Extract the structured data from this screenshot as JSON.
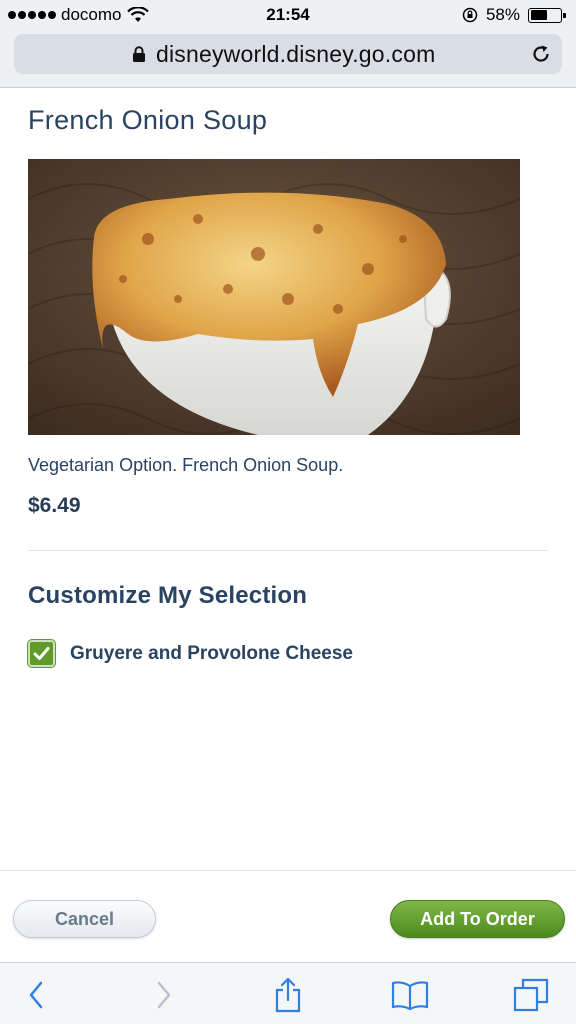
{
  "status_bar": {
    "carrier": "docomo",
    "time": "21:54",
    "battery_percent": "58%",
    "battery_level": 0.58
  },
  "browser": {
    "url": "disneyworld.disney.go.com"
  },
  "item": {
    "title": "French Onion Soup",
    "image_alt": "French onion soup with melted cheese in a white bowl",
    "description": "Vegetarian Option. French Onion Soup.",
    "price": "$6.49"
  },
  "customize": {
    "heading": "Customize My Selection",
    "options": [
      {
        "label": "Gruyere and Provolone Cheese",
        "checked": true
      }
    ]
  },
  "actions": {
    "cancel_label": "Cancel",
    "add_label": "Add To Order"
  },
  "colors": {
    "accent_green": "#5f9a2a",
    "text_navy": "#2a4361",
    "link_blue": "#2f7fe5"
  },
  "toolbar": {
    "icons": [
      "back-icon",
      "forward-icon",
      "share-icon",
      "bookmarks-icon",
      "tabs-icon"
    ]
  }
}
